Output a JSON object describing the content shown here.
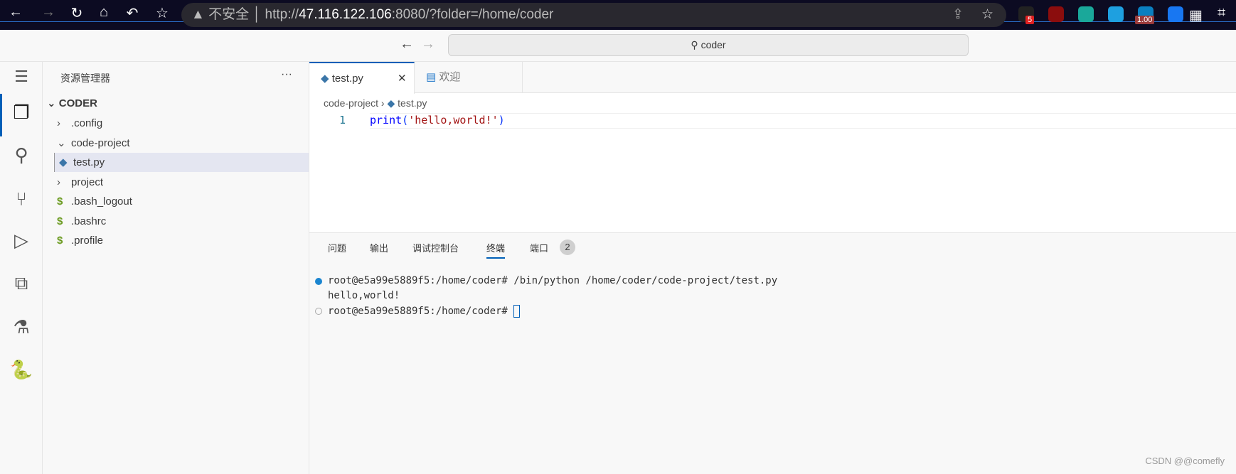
{
  "browser": {
    "security": "不安全",
    "url_scheme": "http://",
    "url_host": "47.116.122.106",
    "url_rest": ":8080/?folder=/home/coder",
    "extensions": [
      {
        "name": "ext-recorder",
        "badge": "5",
        "color": "#222"
      },
      {
        "name": "ublock",
        "badge": "",
        "color": "#8b0d0d"
      },
      {
        "name": "chat",
        "badge": "",
        "color": "#1aa89a"
      },
      {
        "name": "ext-blue",
        "badge": "",
        "color": "#1ea0e0"
      },
      {
        "name": "speed",
        "badge": "1.00",
        "color": "#0a7fc0"
      },
      {
        "name": "ext-cup",
        "badge": "",
        "color": "#1877f2"
      }
    ]
  },
  "titlebar": {
    "search": "coder"
  },
  "sidebar": {
    "title": "资源管理器",
    "more": "···",
    "root": "CODER",
    "items": [
      {
        "label": ".config",
        "type": "folder"
      },
      {
        "label": "code-project",
        "type": "folder-open"
      },
      {
        "label": "test.py",
        "type": "python"
      },
      {
        "label": "project",
        "type": "folder"
      },
      {
        "label": ".bash_logout",
        "type": "shell"
      },
      {
        "label": ".bashrc",
        "type": "shell"
      },
      {
        "label": ".profile",
        "type": "shell"
      }
    ]
  },
  "editor": {
    "tabs": [
      {
        "label": "test.py",
        "active": true
      },
      {
        "label": "欢迎",
        "active": false
      }
    ],
    "breadcrumb": [
      "code-project",
      "test.py"
    ],
    "lines": [
      {
        "no": "1",
        "fn": "print",
        "open": "(",
        "str": "'hello,world!'",
        "close": ")"
      }
    ]
  },
  "panel": {
    "tabs": [
      "问题",
      "输出",
      "调试控制台",
      "终端",
      "端口"
    ],
    "active_tab": "终端",
    "ports_badge": "2",
    "terminal": [
      "root@e5a99e5889f5:/home/coder# /bin/python /home/coder/code-project/test.py",
      "hello,world!",
      "root@e5a99e5889f5:/home/coder# "
    ]
  },
  "watermark": "CSDN @@comefly"
}
